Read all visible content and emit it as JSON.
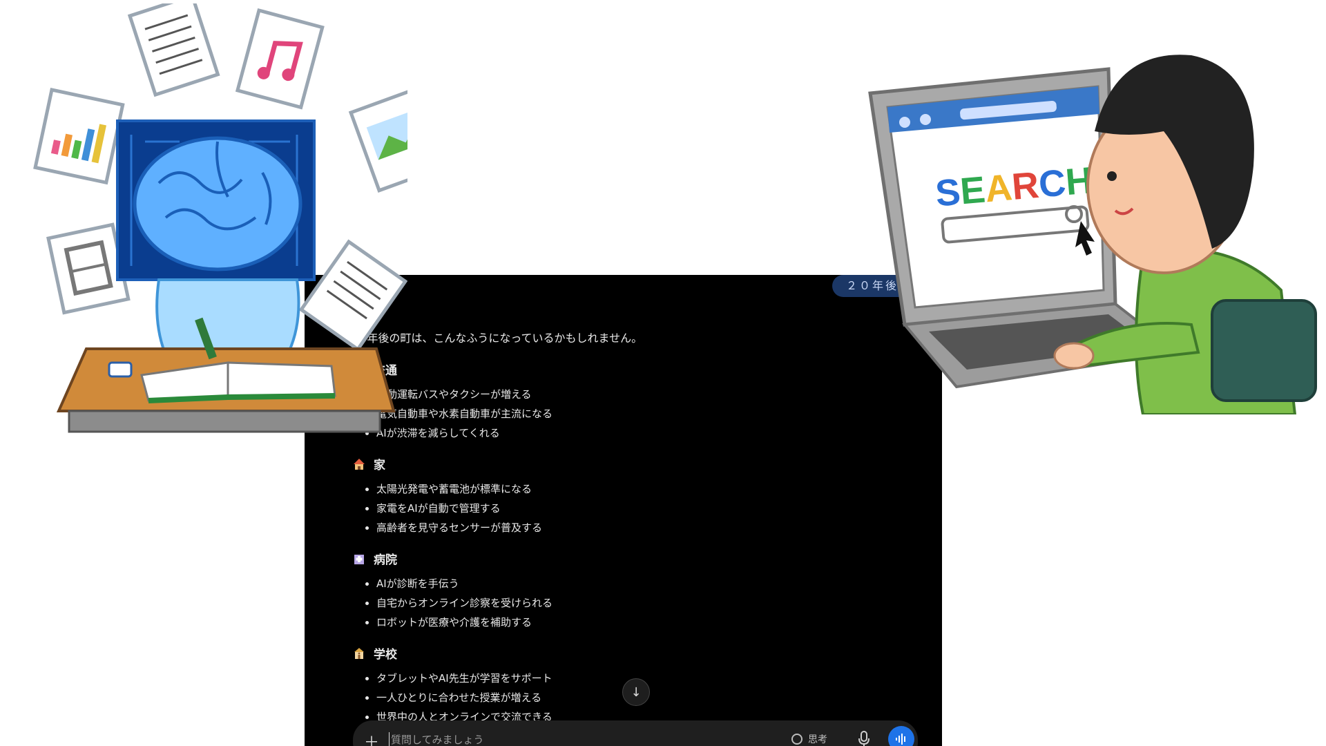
{
  "user_message": "２０年後の",
  "reply": {
    "intro": "20年後の町は、こんなふうになっているかもしれません。",
    "sections": [
      {
        "title": "交通",
        "icon": "bus-icon",
        "items": [
          "自動運転バスやタクシーが増える",
          "電気自動車や水素自動車が主流になる",
          "AIが渋滞を減らしてくれる"
        ]
      },
      {
        "title": "家",
        "icon": "house-icon",
        "items": [
          "太陽光発電や蓄電池が標準になる",
          "家電をAIが自動で管理する",
          "高齢者を見守るセンサーが普及する"
        ]
      },
      {
        "title": "病院",
        "icon": "hospital-icon",
        "items": [
          "AIが診断を手伝う",
          "自宅からオンライン診察を受けられる",
          "ロボットが医療や介護を補助する"
        ]
      },
      {
        "title": "学校",
        "icon": "school-icon",
        "items": [
          "タブレットやAI先生が学習をサポート",
          "一人ひとりに合わせた授業が増える",
          "世界中の人とオンラインで交流できる"
        ]
      }
    ]
  },
  "composer": {
    "placeholder": "質問してみましょう",
    "think_label": "思考",
    "plus_icon": "plus-icon",
    "mic_icon": "microphone-icon",
    "voice_icon": "voice-mode-icon"
  },
  "illustrations": {
    "left": "ai-brain-studying-illustration",
    "right": "person-searching-laptop-illustration",
    "search_word": "SEARCH"
  },
  "colors": {
    "accent": "#1e73e8",
    "bubble": "#1b3766"
  }
}
